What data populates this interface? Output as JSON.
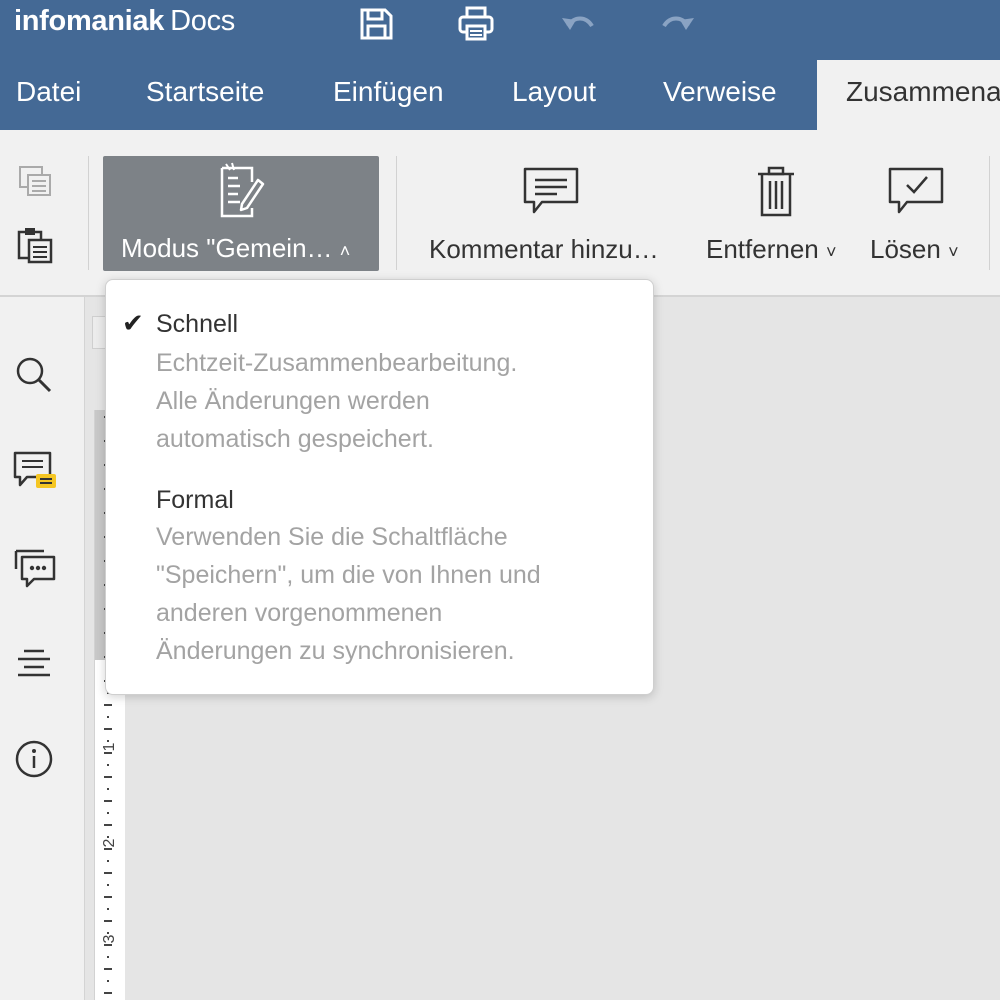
{
  "app": {
    "brand_bold": "infomaniak",
    "brand_light": "Docs"
  },
  "titlebar": {
    "icons": [
      "save-icon",
      "print-icon",
      "undo-icon",
      "redo-icon"
    ]
  },
  "tabs": [
    {
      "label": "Datei",
      "active": false
    },
    {
      "label": "Startseite",
      "active": false
    },
    {
      "label": "Einfügen",
      "active": false
    },
    {
      "label": "Layout",
      "active": false
    },
    {
      "label": "Verweise",
      "active": false
    },
    {
      "label": "Zusammena",
      "active": true
    }
  ],
  "ribbon": {
    "mode_button": {
      "label": "Modus \"Gemein…",
      "icon": "edit-document-icon",
      "chevron": "˄"
    },
    "add_comment": {
      "label": "Kommentar hinzu…",
      "icon": "comment-icon"
    },
    "remove": {
      "label": "Entfernen",
      "icon": "trash-icon",
      "chevron": "˅"
    },
    "resolve": {
      "label": "Lösen",
      "icon": "resolve-comment-icon",
      "chevron": "˅"
    }
  },
  "mode_dropdown": {
    "items": [
      {
        "title": "Schnell",
        "checked": true,
        "description_lines": [
          "Echtzeit-Zusammenbearbeitung.",
          "Alle Änderungen werden",
          "automatisch gespeichert."
        ]
      },
      {
        "title": "Formal",
        "checked": false,
        "description_lines": [
          "Verwenden Sie die Schaltfläche",
          "\"Speichern\", um die von Ihnen und",
          "anderen vorgenommenen",
          "Änderungen zu synchronisieren."
        ]
      }
    ],
    "check_glyph": "✔"
  },
  "left_sidebar": {
    "icons": [
      "search-icon",
      "comments-panel-icon",
      "chat-icon",
      "navigation-icon",
      "info-icon"
    ]
  },
  "ruler": {
    "numbers": [
      "1",
      "2",
      "3"
    ]
  },
  "colors": {
    "header": "#446995",
    "ribbon": "#f1f1f1",
    "active_button": "#7d8287"
  }
}
